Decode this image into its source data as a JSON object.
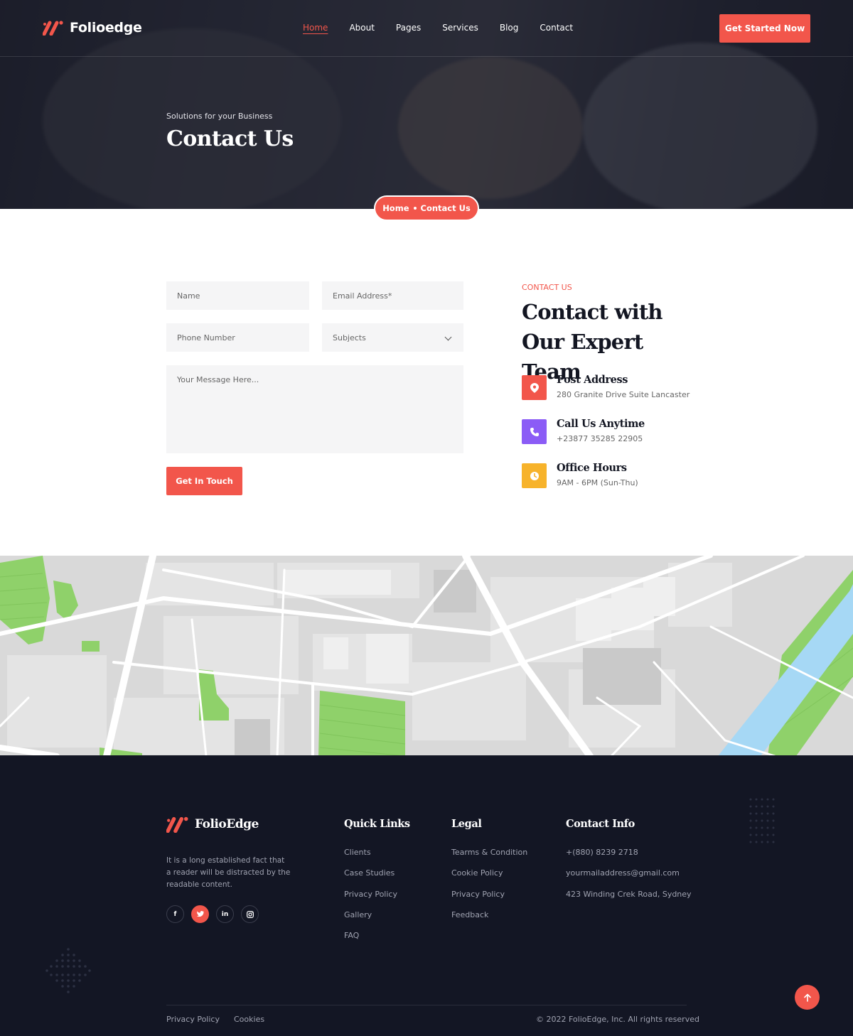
{
  "brand": {
    "name": "Folioedge",
    "accent": "#f2564b"
  },
  "nav": {
    "items": [
      "Home",
      "About",
      "Pages",
      "Services",
      "Blog",
      "Contact"
    ],
    "active": "Home",
    "cta": "Get Started Now"
  },
  "hero": {
    "subtitle": "Solutions for your Business",
    "title": "Contact Us",
    "breadcrumb": {
      "home": "Home",
      "current": "Contact Us"
    }
  },
  "form": {
    "name_placeholder": "Name",
    "email_placeholder": "Email Address*",
    "phone_placeholder": "Phone Number",
    "subject_selected": "Subjects",
    "message_placeholder": "Your Message Here...",
    "submit": "Get In Touch"
  },
  "contact": {
    "tag": "CONTACT US",
    "title": "Contact with Our Expert Team",
    "items": [
      {
        "icon": "location-pin-icon",
        "color": "#f2564b",
        "title": "Post Address",
        "text": "280 Granite Drive Suite Lancaster"
      },
      {
        "icon": "phone-icon",
        "color": "#8b5cf6",
        "title": "Call Us Anytime",
        "text": "+23877 35285 22905"
      },
      {
        "icon": "clock-icon",
        "color": "#f7b32b",
        "title": "Office Hours",
        "text": "9AM - 6PM (Sun-Thu)"
      }
    ]
  },
  "footer": {
    "brand": "FolioEdge",
    "description": "It is a long established fact that a reader will be distracted by the readable content.",
    "social": [
      "f",
      "t",
      "in",
      "ig"
    ],
    "quick_links": {
      "heading": "Quick Links",
      "items": [
        "Clients",
        "Case Studies",
        "Privacy Policy",
        "Gallery",
        "FAQ"
      ]
    },
    "legal": {
      "heading": "Legal",
      "items": [
        "Tearms & Condition",
        "Cookie Policy",
        "Privacy Policy",
        "Feedback"
      ]
    },
    "contact_info": {
      "heading": "Contact Info",
      "items": [
        "+(880) 8239 2718",
        "yourmailaddress@gmail.com",
        "423 Winding Crek Road, Sydney"
      ]
    },
    "bottom_links": [
      "Privacy Policy",
      "Cookies"
    ],
    "copyright": "© 2022 FolioEdge, Inc. All rights reserved"
  }
}
